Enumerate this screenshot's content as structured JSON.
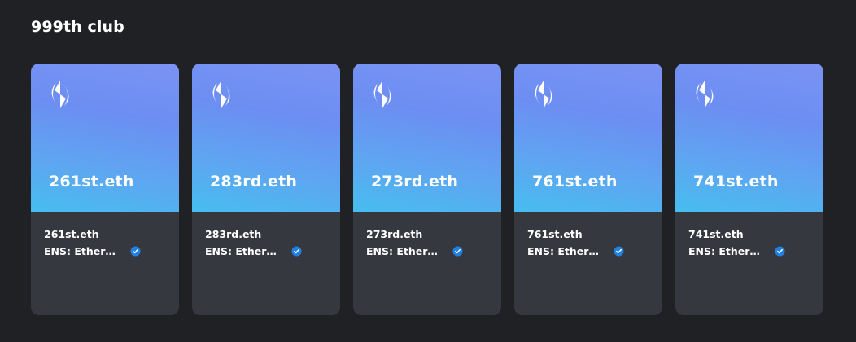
{
  "section": {
    "title": "999th club"
  },
  "cards": [
    {
      "image_label": "261st.eth",
      "name": "261st.eth",
      "collection": "ENS: Ethereum Name Service",
      "verified": true
    },
    {
      "image_label": "283rd.eth",
      "name": "283rd.eth",
      "collection": "ENS: Ethereum Name Service",
      "verified": true
    },
    {
      "image_label": "273rd.eth",
      "name": "273rd.eth",
      "collection": "ENS: Ethereum Name Service",
      "verified": true
    },
    {
      "image_label": "761st.eth",
      "name": "761st.eth",
      "collection": "ENS: Ethereum Name Service",
      "verified": true
    },
    {
      "image_label": "741st.eth",
      "name": "741st.eth",
      "collection": "ENS: Ethereum Name Service",
      "verified": true
    }
  ],
  "colors": {
    "background": "#202124",
    "card_body": "#363840",
    "gradient_top": "#7b93f5",
    "gradient_bottom": "#46bdef",
    "verified_badge": "#2081e2"
  },
  "icons": {
    "logo": "ens-logo-icon",
    "badge": "verified-check-icon"
  }
}
